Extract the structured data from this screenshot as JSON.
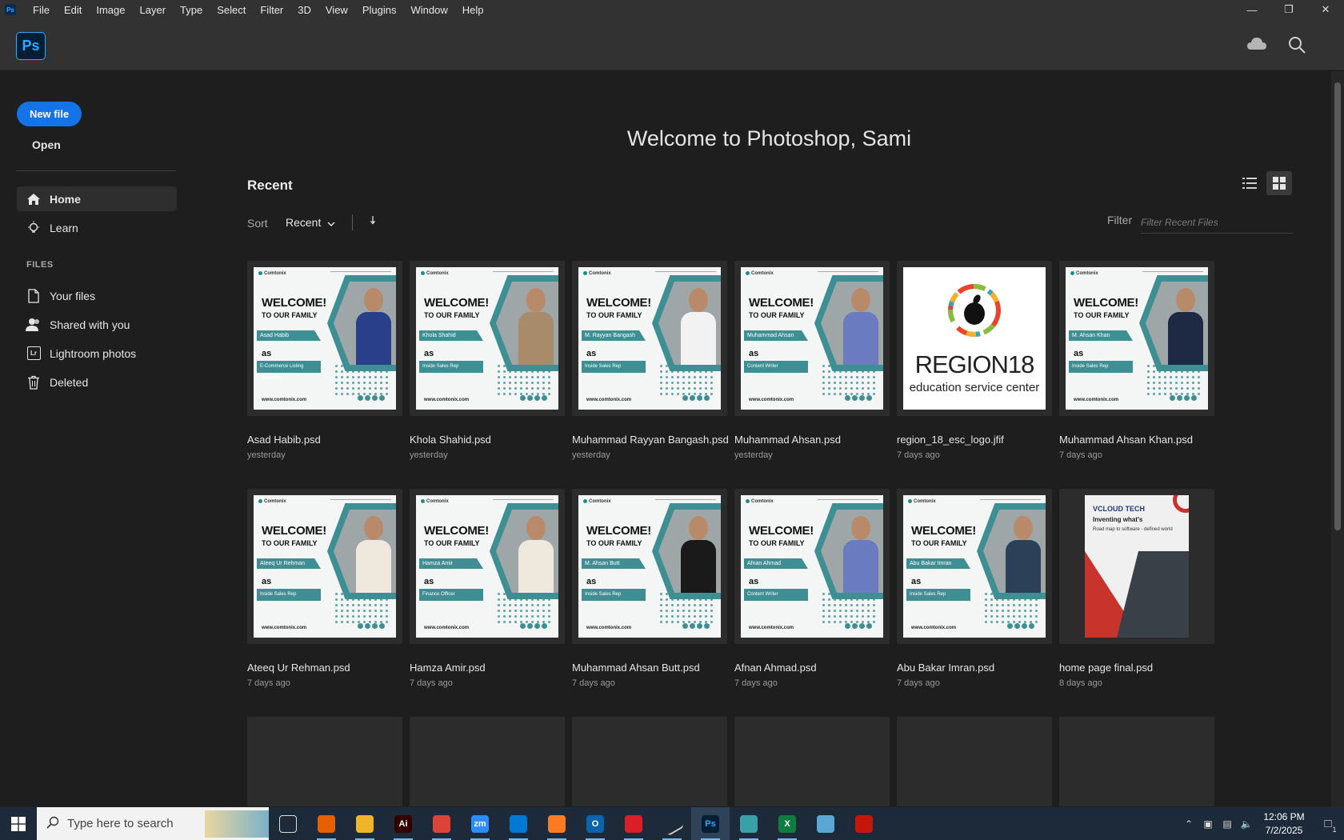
{
  "menubar": {
    "app_badge": "Ps",
    "items": [
      "File",
      "Edit",
      "Image",
      "Layer",
      "Type",
      "Select",
      "Filter",
      "3D",
      "View",
      "Plugins",
      "Window",
      "Help"
    ]
  },
  "app": {
    "logo": "Ps"
  },
  "sidebar": {
    "new_file": "New file",
    "open": "Open",
    "nav": [
      {
        "label": "Home",
        "icon": "home-icon",
        "active": true
      },
      {
        "label": "Learn",
        "icon": "lightbulb-icon",
        "active": false
      }
    ],
    "files_header": "FILES",
    "files": [
      {
        "label": "Your files",
        "icon": "document-icon"
      },
      {
        "label": "Shared with you",
        "icon": "people-icon"
      },
      {
        "label": "Lightroom photos",
        "icon": "lightroom-icon",
        "badge": "Lr"
      },
      {
        "label": "Deleted",
        "icon": "trash-icon"
      }
    ]
  },
  "main": {
    "welcome": "Welcome to Photoshop, Sami",
    "recent_title": "Recent",
    "sort_label": "Sort",
    "sort_value": "Recent",
    "filter_label": "Filter",
    "filter_placeholder": "Filter Recent Files"
  },
  "files": [
    {
      "name": "Asad Habib.psd",
      "date": "yesterday",
      "kind": "poster",
      "person": "Asad Habib",
      "role": "E-Commerce Listing Specialist",
      "shirt": "#2a3f8a"
    },
    {
      "name": "Khola Shahid.psd",
      "date": "yesterday",
      "kind": "poster",
      "person": "Khola Shahid",
      "role": "Inside Sales Rep",
      "shirt": "#a88b6b"
    },
    {
      "name": "Muhammad Rayyan Bangash.psd",
      "date": "yesterday",
      "kind": "poster",
      "person": "M. Rayyan Bangash",
      "role": "Inside Sales Rep",
      "shirt": "#f2f2f2"
    },
    {
      "name": "Muhammad Ahsan.psd",
      "date": "yesterday",
      "kind": "poster",
      "person": "Muhammad Ahsan",
      "role": "Content Writer",
      "shirt": "#6a7bc0"
    },
    {
      "name": "region_18_esc_logo.jfif",
      "date": "7 days ago",
      "kind": "region",
      "big": "REGION18",
      "sub": "education service center"
    },
    {
      "name": "Muhammad Ahsan Khan.psd",
      "date": "7 days ago",
      "kind": "poster",
      "person": "M. Ahsan Khan",
      "role": "Inside Sales Rep",
      "shirt": "#1e2a44"
    },
    {
      "name": "Ateeq Ur Rehman.psd",
      "date": "7 days ago",
      "kind": "poster",
      "person": "Ateeq Ur Rehman",
      "role": "Inside Sales Rep",
      "shirt": "#efe8dc"
    },
    {
      "name": "Hamza Amir.psd",
      "date": "7 days ago",
      "kind": "poster",
      "person": "Hamza Amir",
      "role": "Finance Officer",
      "shirt": "#efe8dc"
    },
    {
      "name": "Muhammad Ahsan Butt.psd",
      "date": "7 days ago",
      "kind": "poster",
      "person": "M. Ahsan Butt",
      "role": "Inside Sales Rep",
      "shirt": "#1a1a1a"
    },
    {
      "name": "Afnan Ahmad.psd",
      "date": "7 days ago",
      "kind": "poster",
      "person": "Afnan Ahmad",
      "role": "Content Writer",
      "shirt": "#6a7bc0"
    },
    {
      "name": "Abu Bakar Imran.psd",
      "date": "7 days ago",
      "kind": "poster",
      "person": "Abu Bakar Imran",
      "role": "Inside Sales Rep",
      "shirt": "#2c4058"
    },
    {
      "name": "home page final.psd",
      "date": "8 days ago",
      "kind": "vcloud",
      "t1": "VCLOUD TECH",
      "t2": "Inventing what's",
      "t3": "Road map to software - defined world"
    }
  ],
  "poster_common": {
    "brand": "Comtonix",
    "welcome": "WELCOME!",
    "family": "TO OUR FAMILY",
    "as": "as",
    "url": "www.comtonix.com"
  },
  "taskbar": {
    "search_placeholder": "Type here to search",
    "apps": [
      {
        "icon": "task-view-icon",
        "label": "",
        "color": "transparent"
      },
      {
        "icon": "firefox-icon",
        "label": "",
        "color": "#e66000"
      },
      {
        "icon": "file-explorer-icon",
        "label": "",
        "color": "#f0b429"
      },
      {
        "icon": "illustrator-icon",
        "label": "Ai",
        "color": "#330000"
      },
      {
        "icon": "chrome-icon",
        "label": "",
        "color": "#db4437"
      },
      {
        "icon": "zoom-icon",
        "label": "zm",
        "color": "#2d8cff"
      },
      {
        "icon": "vscode-icon",
        "label": "",
        "color": "#0078d4"
      },
      {
        "icon": "xampp-icon",
        "label": "",
        "color": "#fb7a24"
      },
      {
        "icon": "outlook-icon",
        "label": "O",
        "color": "#0a64ad"
      },
      {
        "icon": "creative-cloud-icon",
        "label": "",
        "color": "#da1f26"
      },
      {
        "icon": "pen-tool-icon",
        "label": "",
        "color": "transparent"
      },
      {
        "icon": "photoshop-icon",
        "label": "Ps",
        "color": "#001e36"
      },
      {
        "icon": "diamond-app-icon",
        "label": "",
        "color": "#3aa0a8"
      },
      {
        "icon": "excel-icon",
        "label": "X",
        "color": "#107c41"
      },
      {
        "icon": "notes-app-icon",
        "label": "",
        "color": "#5aa7d6"
      },
      {
        "icon": "acrobat-icon",
        "label": "",
        "color": "#c4160b"
      }
    ],
    "time": "12:06 PM",
    "date": "7/2/2025",
    "notifications": "1"
  }
}
